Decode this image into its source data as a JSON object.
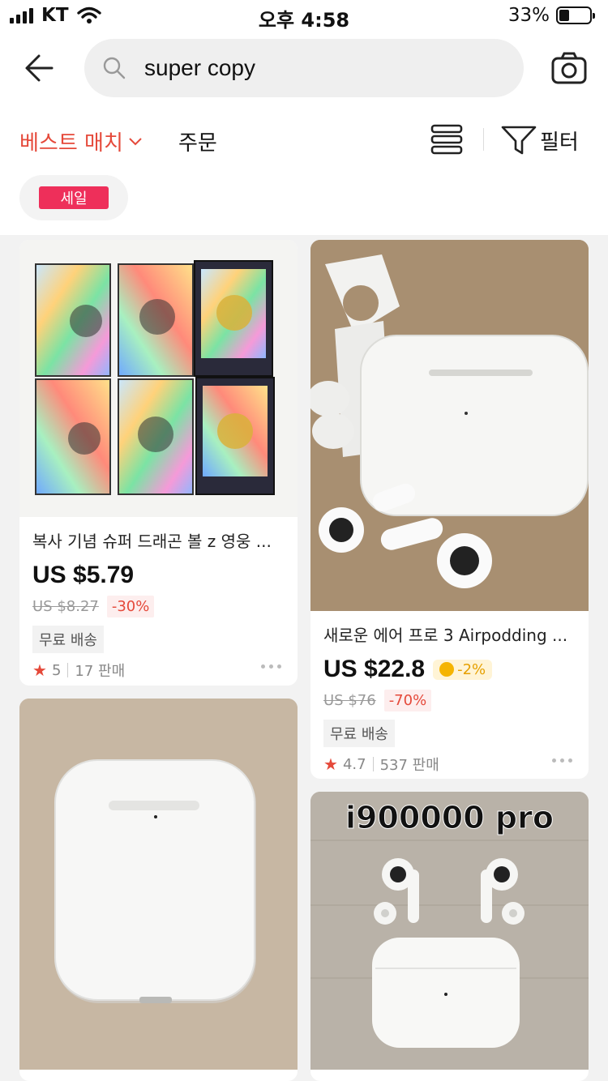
{
  "status_bar": {
    "carrier": "KT",
    "time": "오후 4:58",
    "battery": "33%",
    "battery_level": 0.33
  },
  "search": {
    "query": "super copy"
  },
  "sort": {
    "best_match": "베스트 매치",
    "orders": "주문",
    "filter": "필터"
  },
  "chip": {
    "label": "세일"
  },
  "products": [
    {
      "title": "복사 기념 슈퍼 드래곤 볼 z 영웅 ...",
      "price": "US $5.79",
      "old_price": "US $8.27",
      "discount": "-30%",
      "shipping": "무료 배송",
      "rating": "5",
      "sold": "17 판매",
      "coin": ""
    },
    {
      "title": "새로운 에어 프로 3 Airpodding ...",
      "price": "US $22.8",
      "coin": "-2%",
      "old_price": "US $76",
      "discount": "-70%",
      "shipping": "무료 배송",
      "rating": "4.7",
      "sold": "537 판매"
    },
    {
      "title": "",
      "image_text": ""
    },
    {
      "title": "",
      "image_text": "i900000 pro"
    }
  ],
  "colors": {
    "accent": "#e5493a",
    "chip": "#ee2f5a",
    "background": "#f2f2f2"
  },
  "icons": [
    "back-arrow-icon",
    "search-icon",
    "camera-icon",
    "chevron-down-icon",
    "list-layout-icon",
    "filter-icon",
    "star-icon",
    "more-dots-icon",
    "coin-icon"
  ]
}
